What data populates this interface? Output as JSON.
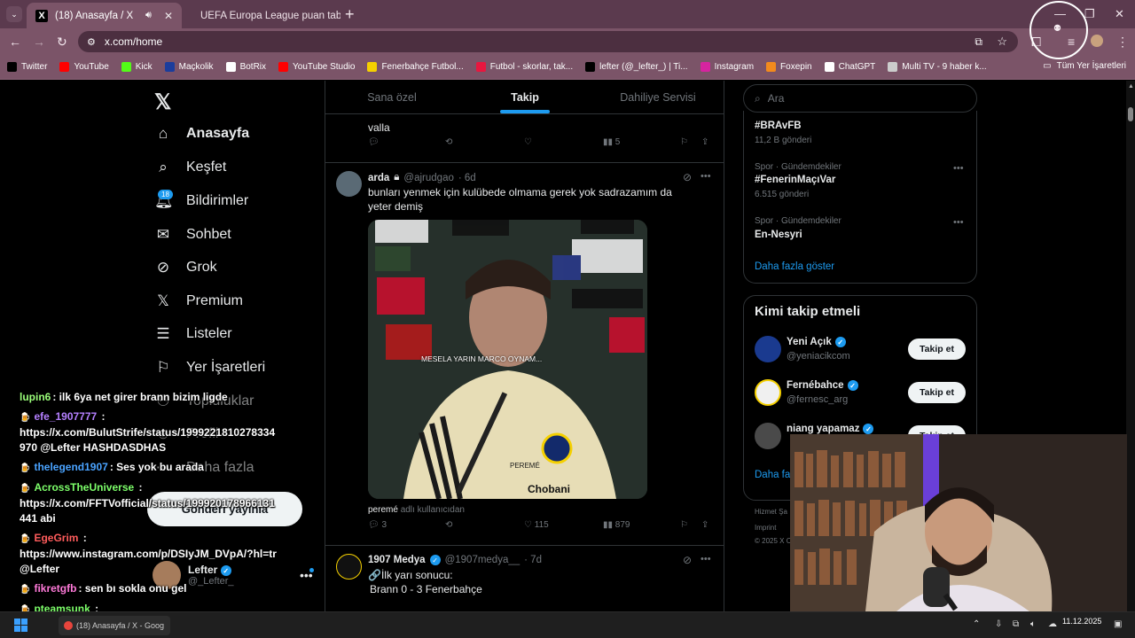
{
  "browser": {
    "tabs": [
      {
        "title": "(18) Anasayfa / X",
        "active": true
      },
      {
        "title": "UEFA Europa League puan tabl",
        "active": false
      }
    ],
    "url": "x.com/home",
    "bookmarks": [
      {
        "label": "Twitter",
        "icon": "x-icon",
        "color": "#000000"
      },
      {
        "label": "YouTube",
        "icon": "youtube-icon",
        "color": "#ff0000"
      },
      {
        "label": "Kick",
        "icon": "kick-icon",
        "color": "#53fc18"
      },
      {
        "label": "Maçkolik",
        "icon": "mackolik-icon",
        "color": "#1b3d9c"
      },
      {
        "label": "BotRix",
        "icon": "botrix-icon",
        "color": "#ffffff"
      },
      {
        "label": "YouTube Studio",
        "icon": "youtube-studio-icon",
        "color": "#ff0000"
      },
      {
        "label": "Fenerbahçe Futbol...",
        "icon": "fenerbahce-icon",
        "color": "#f5d000"
      },
      {
        "label": "Futbol - skorlar, tak...",
        "icon": "futbol-icon",
        "color": "#e8173f"
      },
      {
        "label": "lefter (@_lefter_) | Ti...",
        "icon": "tiktok-icon",
        "color": "#000000"
      },
      {
        "label": "Instagram",
        "icon": "instagram-icon",
        "color": "#d6249f"
      },
      {
        "label": "Foxepin",
        "icon": "fox-icon",
        "color": "#f28a1d"
      },
      {
        "label": "ChatGPT",
        "icon": "chatgpt-icon",
        "color": "#ffffff"
      },
      {
        "label": "Multi TV - 9 haber k...",
        "icon": "tv-icon",
        "color": "#cccccc"
      }
    ],
    "all_bookmarks": "Tüm Yer İşaretleri"
  },
  "nav": {
    "badge": "18",
    "items": [
      {
        "label": "Anasayfa",
        "icon": "home-icon",
        "glyph": "⌂"
      },
      {
        "label": "Keşfet",
        "icon": "search-icon",
        "glyph": "⌕"
      },
      {
        "label": "Bildirimler",
        "icon": "bell-icon",
        "glyph": "🔔︎"
      },
      {
        "label": "Sohbet",
        "icon": "mail-icon",
        "glyph": "✉"
      },
      {
        "label": "Grok",
        "icon": "grok-icon",
        "glyph": "⊘"
      },
      {
        "label": "Premium",
        "icon": "x-premium-icon",
        "glyph": "𝕏"
      },
      {
        "label": "Listeler",
        "icon": "list-icon",
        "glyph": "☰"
      },
      {
        "label": "Yer İşaretleri",
        "icon": "bookmark-icon",
        "glyph": "⚐"
      },
      {
        "label": "Topluluklar",
        "icon": "communities-icon",
        "glyph": "⚇"
      },
      {
        "label": "Profil",
        "icon": "profile-icon",
        "glyph": "☺"
      },
      {
        "label": "Daha fazla",
        "icon": "more-icon",
        "glyph": "⋯"
      }
    ],
    "post_button": "Gönderi yayınla",
    "account": {
      "name": "Lefter",
      "handle": "@_Lefter_"
    }
  },
  "chat": [
    {
      "user": "lupin6",
      "color": "#9bff7a",
      "text": ": ilk 6ya net girer brann bizim ligde"
    },
    {
      "user": "efe_1907777",
      "color": "#b580ff",
      "text": " :",
      "extra": "https://x.com/BulutStrife/status/1999221810278334970 @Lefter HASHDASDHAS"
    },
    {
      "user": "thelegend1907",
      "color": "#4aa3ff",
      "text": ": Ses yok bu arada"
    },
    {
      "user": "AcrossTheUniverse",
      "color": "#7dff6a",
      "text": " :",
      "extra": "https://x.com/FFTVofficial/status/199920178966131441 abi"
    },
    {
      "user": "EgeGrim",
      "color": "#ff5c5c",
      "text": " :",
      "extra": "https://www.instagram.com/p/DSIyJM_DVpA/?hl=tr @Lefter"
    },
    {
      "user": "fikretgfb",
      "color": "#ff7ad9",
      "text": ": sen bı sokla onu gel"
    },
    {
      "user": "pteamsunk",
      "color": "#7dff6a",
      "text": " :"
    },
    {
      "user": "kadirgfb",
      "color": "#ffffff",
      "text": ": SES YOK ABİ"
    }
  ],
  "timeline": {
    "tabs": [
      "Sana özel",
      "Takip",
      "Dahiliye Servisi"
    ],
    "active_tab": 1,
    "prev_post": {
      "text": "valla",
      "views": "5"
    },
    "post1": {
      "name": "arda",
      "handle": "@ajrudgao",
      "time": "· 6d",
      "text": "bunları yenmek için kulübede olmama gerek yok sadrazamım da yeter demiş",
      "video_caption": "MESELA YARIN MARCO OYNAM...",
      "quote_user": "peremé",
      "quote_suffix": "adlı kullanıcıdan",
      "replies": "3",
      "likes": "115",
      "views": "879"
    },
    "post2": {
      "name": "1907 Medya",
      "handle": "@1907medya__",
      "time": "· 7d",
      "line1": "🔗İlk yarı sonucu:",
      "line2": "Brann 0 - 3 Fenerbahçe"
    }
  },
  "sidebar": {
    "search_placeholder": "Ara",
    "trends": [
      {
        "meta": "",
        "name": "#BRAvFB",
        "count": "11,2 B gönderi"
      },
      {
        "meta": "Spor · Gündemdekiler",
        "name": "#FenerinMaçıVar",
        "count": "6.515 gönderi"
      },
      {
        "meta": "Spor · Gündemdekiler",
        "name": "En-Nesyri",
        "count": ""
      }
    ],
    "show_more": "Daha fazla göster",
    "who_to_follow": "Kimi takip etmeli",
    "suggestions": [
      {
        "name": "Yeni Açık",
        "handle": "@yeniacikcom",
        "button": "Takip et",
        "color": "#1a3a8f"
      },
      {
        "name": "Fernébahce",
        "handle": "@fernesc_arg",
        "button": "Takip et",
        "color": "#f0f0f0"
      },
      {
        "name": "niang yapamaz",
        "handle": "",
        "button": "Takip et",
        "color": "#4a4a4a"
      }
    ],
    "more_partial": "Daha fa",
    "footer1": "Hizmet Şa",
    "footer2": "Imprint",
    "footer3": "© 2025 X C"
  },
  "taskbar": {
    "app": "(18) Anasayfa / X - Goog",
    "date": "11.12.2025"
  }
}
